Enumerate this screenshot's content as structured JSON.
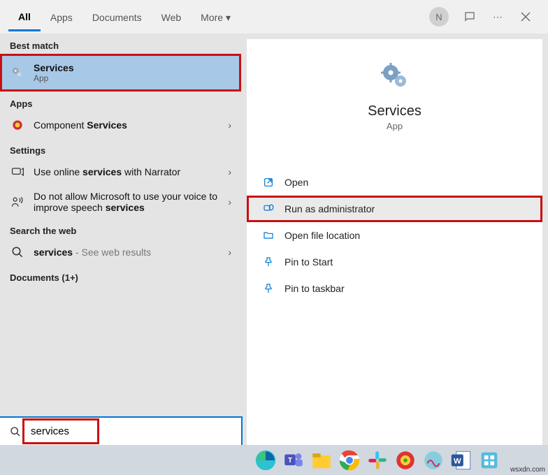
{
  "tabs": {
    "all": "All",
    "apps": "Apps",
    "documents": "Documents",
    "web": "Web",
    "more": "More"
  },
  "header": {
    "avatar_letter": "N"
  },
  "left": {
    "best_match": "Best match",
    "services_title": "Services",
    "services_sub": "App",
    "apps_label": "Apps",
    "component_pre": "Component ",
    "component_bold": "Services",
    "settings_label": "Settings",
    "narrator_pre": "Use online ",
    "narrator_bold": "services",
    "narrator_post": " with Narrator",
    "ms_voice_pre": "Do not allow Microsoft to use your voice to improve speech ",
    "ms_voice_bold": "services",
    "search_web_label": "Search the web",
    "web_pre": "services",
    "web_post": " - See web results",
    "documents_label": "Documents (1+)"
  },
  "right": {
    "title": "Services",
    "sub": "App",
    "actions": {
      "open": "Open",
      "run_admin": "Run as administrator",
      "open_loc": "Open file location",
      "pin_start": "Pin to Start",
      "pin_taskbar": "Pin to taskbar"
    }
  },
  "search": {
    "value": "services"
  },
  "watermark": "wsxdn.com"
}
